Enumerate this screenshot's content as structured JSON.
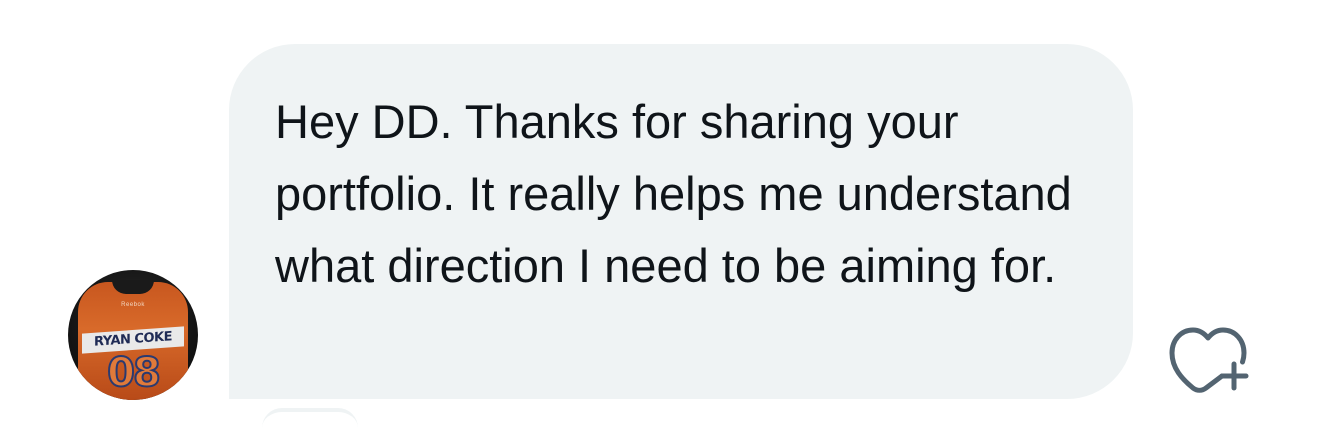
{
  "message": {
    "text": "Hey DD. Thanks for sharing your portfolio. It really helps me understand what direction I need to be aiming for."
  },
  "avatar": {
    "jersey_brand": "Reebok",
    "jersey_name": "RYAN COKE",
    "jersey_number": "08"
  },
  "actions": {
    "react_icon": "heart-plus-icon"
  },
  "colors": {
    "bubble_bg": "#eff3f4",
    "text": "#0f1419",
    "icon": "#536471"
  }
}
